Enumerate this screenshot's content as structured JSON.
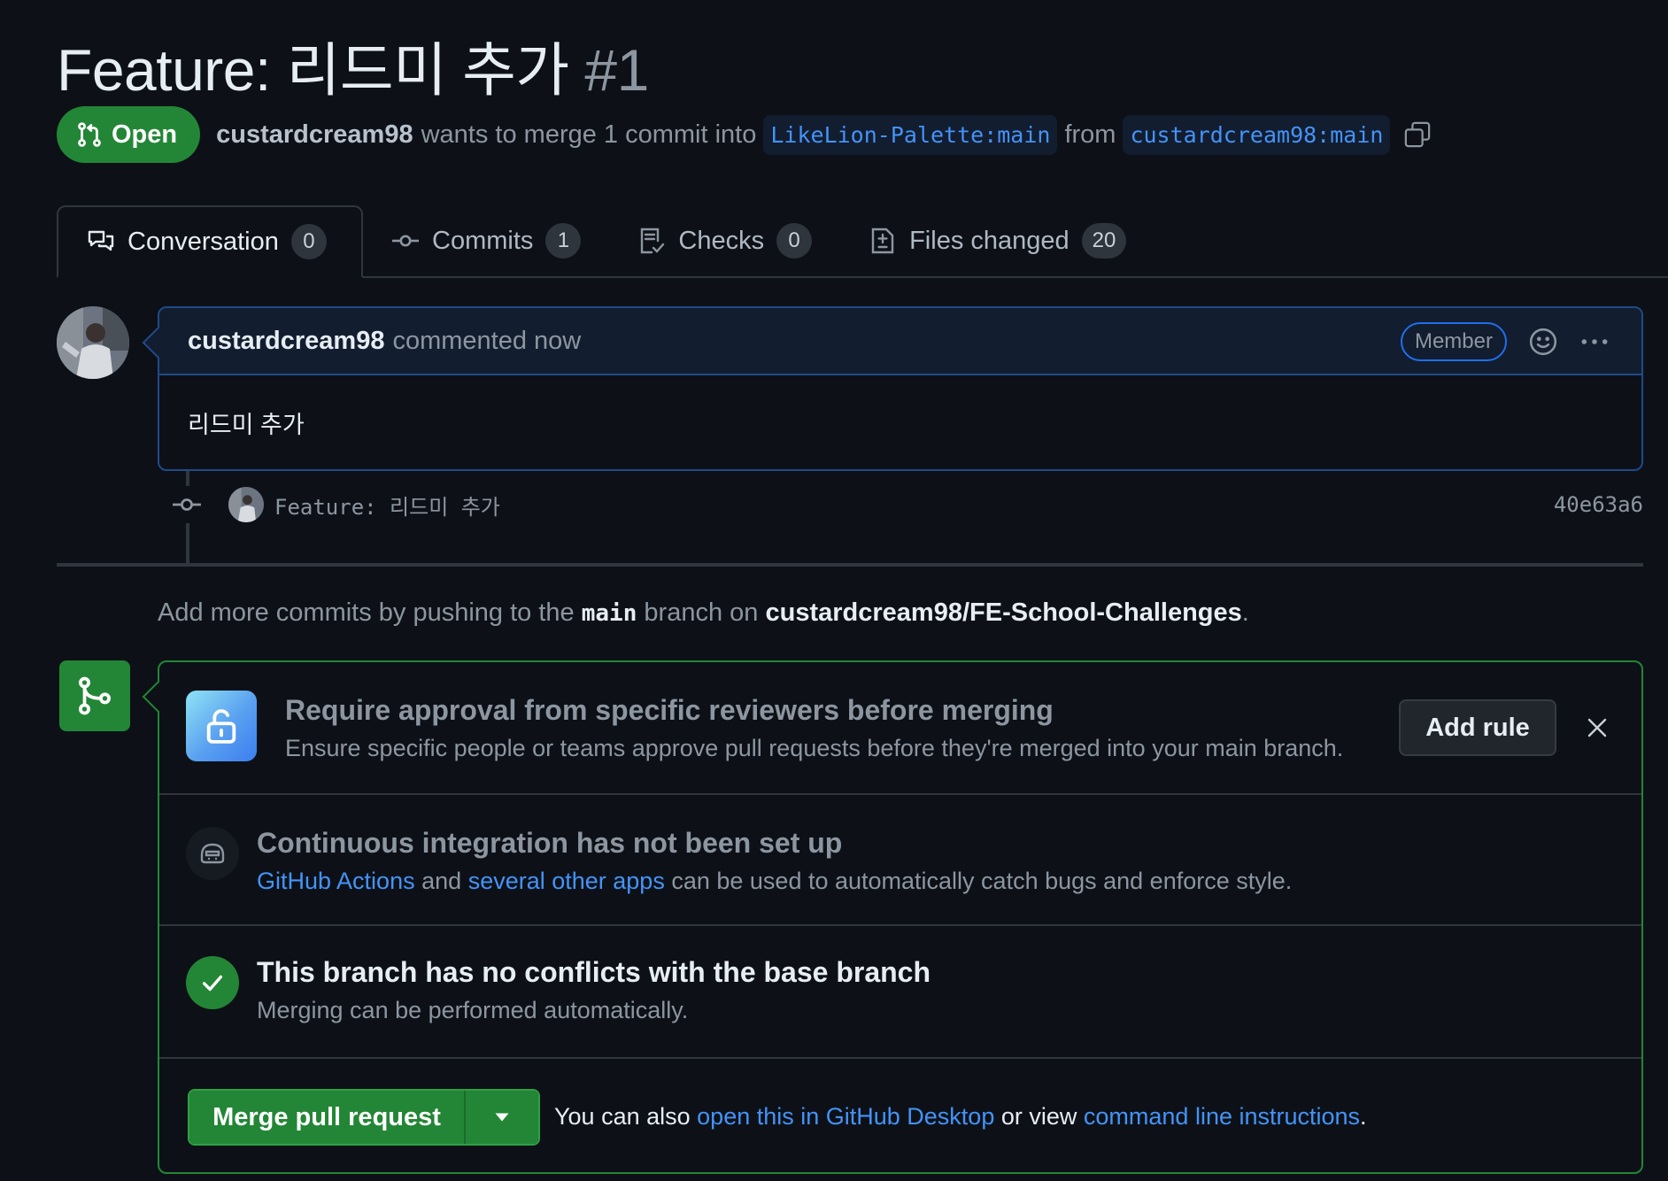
{
  "pr": {
    "title": "Feature: 리드미 추가",
    "number": "#1",
    "state": "Open",
    "author": "custardcream98",
    "merge_text": "wants to merge 1 commit into",
    "base_branch": "LikeLion-Palette:main",
    "from_text": "from",
    "head_branch": "custardcream98:main"
  },
  "tabs": [
    {
      "label": "Conversation",
      "count": "0"
    },
    {
      "label": "Commits",
      "count": "1"
    },
    {
      "label": "Checks",
      "count": "0"
    },
    {
      "label": "Files changed",
      "count": "20"
    }
  ],
  "comment": {
    "author": "custardcream98",
    "action": "commented now",
    "role": "Member",
    "body": "리드미 추가"
  },
  "commit": {
    "message": "Feature: 리드미 추가",
    "sha": "40e63a6"
  },
  "push_hint": {
    "prefix": "Add more commits by pushing to the",
    "branch": "main",
    "middle": "branch on",
    "repo": "custardcream98/FE-School-Challenges",
    "suffix": "."
  },
  "merge": {
    "approval": {
      "title": "Require approval from specific reviewers before merging",
      "desc": "Ensure specific people or teams approve pull requests before they're merged into your main branch.",
      "button": "Add rule"
    },
    "ci": {
      "title": "Continuous integration has not been set up",
      "link1": "GitHub Actions",
      "and": "and",
      "link2": "several other apps",
      "desc": "can be used to automatically catch bugs and enforce style."
    },
    "conflicts": {
      "title": "This branch has no conflicts with the base branch",
      "desc": "Merging can be performed automatically."
    },
    "action": {
      "button": "Merge pull request",
      "hint_prefix": "You can also",
      "link1": "open this in GitHub Desktop",
      "hint_middle": "or view",
      "link2": "command line instructions",
      "hint_suffix": "."
    }
  },
  "colors": {
    "background": "#0d1117",
    "accent_green": "#238636",
    "link_blue": "#4493f8",
    "border": "#30363d"
  }
}
